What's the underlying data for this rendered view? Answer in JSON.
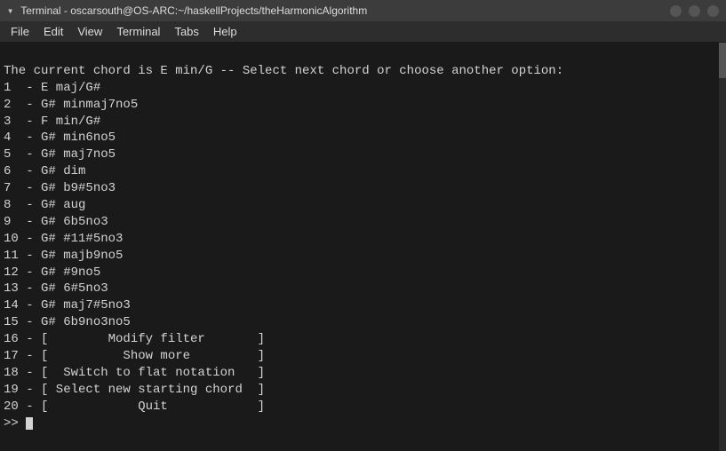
{
  "titlebar": {
    "chevron": "▾",
    "title": "Terminal - oscarsouth@OS-ARC:~/haskellProjects/theHarmonicAlgorithm",
    "minimize_label": "–",
    "maximize_label": "□",
    "close_label": "×"
  },
  "menubar": {
    "items": [
      "File",
      "Edit",
      "View",
      "Terminal",
      "Tabs",
      "Help"
    ]
  },
  "terminal": {
    "header": "The current chord is E min/G -- Select next chord or choose another option:",
    "lines": [
      "",
      "1  - E maj/G#",
      "2  - G# minmaj7no5",
      "3  - F min/G#",
      "4  - G# min6no5",
      "5  - G# maj7no5",
      "6  - G# dim",
      "7  - G# b9#5no3",
      "8  - G# aug",
      "9  - G# 6b5no3",
      "10 - G# #11#5no3",
      "11 - G# majb9no5",
      "12 - G# #9no5",
      "13 - G# 6#5no3",
      "14 - G# maj7#5no3",
      "15 - G# 6b9no3no5",
      "16 - [        Modify filter       ]",
      "17 - [          Show more         ]",
      "18 - [  Switch to flat notation   ]",
      "19 - [ Select new starting chord  ]",
      "20 - [            Quit            ]"
    ],
    "prompt": ">>"
  }
}
